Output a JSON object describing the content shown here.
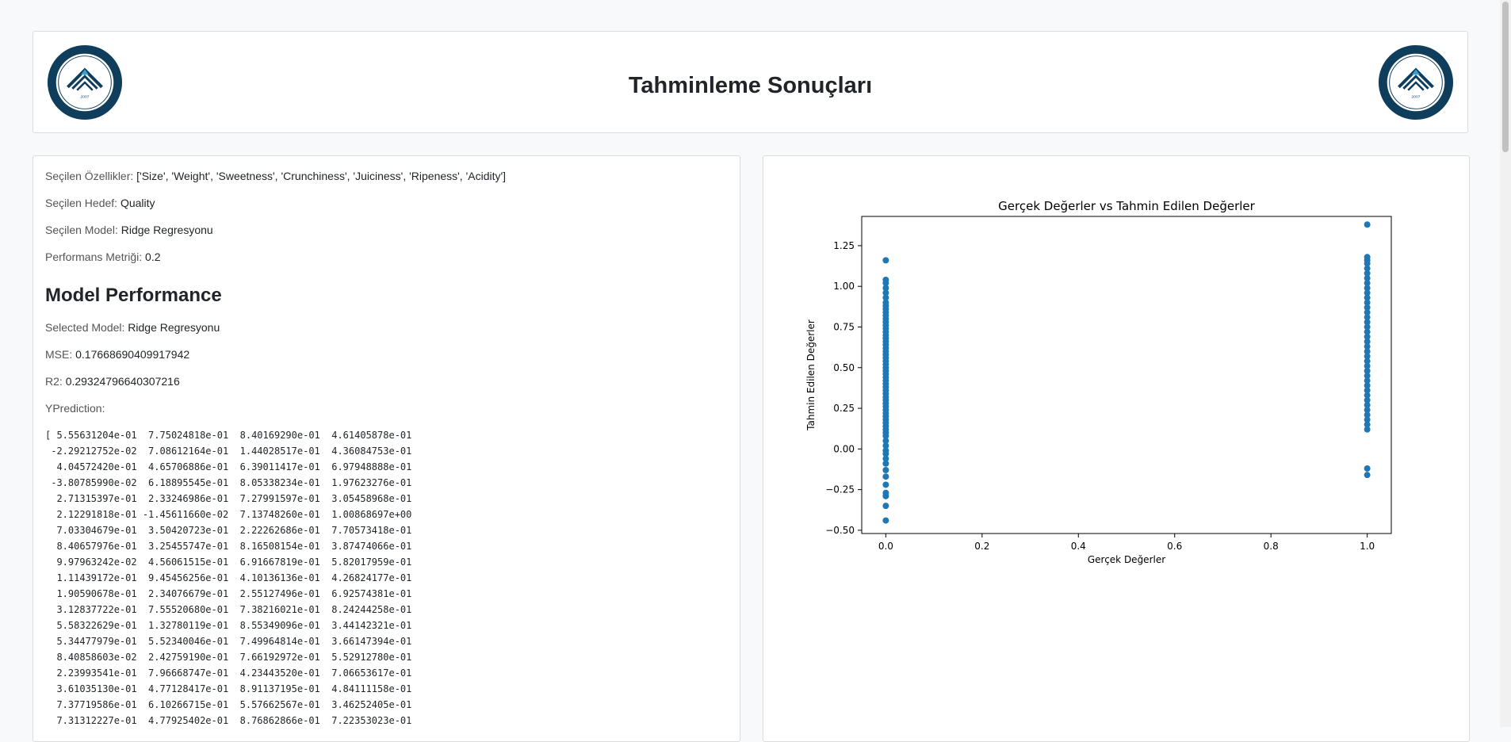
{
  "header": {
    "title": "Tahminleme Sonuçları",
    "logo_left": "university-logo",
    "logo_right": "university-logo",
    "logo_text": "ÇANKIRI KARATEKİN ÜNİVERSİTESİ",
    "logo_year": "2007"
  },
  "summary": {
    "features_label": "Seçilen Özellikler:",
    "features_value": "['Size', 'Weight', 'Sweetness', 'Crunchiness', 'Juiciness', 'Ripeness', 'Acidity']",
    "target_label": "Seçilen Hedef:",
    "target_value": "Quality",
    "model_label": "Seçilen Model:",
    "model_value": "Ridge Regresyonu",
    "metric_label": "Performans Metriği:",
    "metric_value": "0.2"
  },
  "performance": {
    "heading": "Model Performance",
    "selected_model_label": "Selected Model:",
    "selected_model_value": "Ridge Regresyonu",
    "mse_label": "MSE:",
    "mse_value": "0.17668690409917942",
    "r2_label": "R2:",
    "r2_value": "0.29324796640307216",
    "yprediction_label": "YPrediction:",
    "yprediction_lines": [
      "[ 5.55631204e-01  7.75024818e-01  8.40169290e-01  4.61405878e-01",
      " -2.29212752e-02  7.08612164e-01  1.44028517e-01  4.36084753e-01",
      "  4.04572420e-01  4.65706886e-01  6.39011417e-01  6.97948888e-01",
      " -3.80785990e-02  6.18895545e-01  8.05338234e-01  1.97623276e-01",
      "  2.71315397e-01  2.33246986e-01  7.27991597e-01  3.05458968e-01",
      "  2.12291818e-01 -1.45611660e-02  7.13748260e-01  1.00868697e+00",
      "  7.03304679e-01  3.50420723e-01  2.22262686e-01  7.70573418e-01",
      "  8.40657976e-01  3.25455747e-01  8.16508154e-01  3.87474066e-01",
      "  9.97963242e-02  4.56061515e-01  6.91667819e-01  5.82017959e-01",
      "  1.11439172e-01  9.45456256e-01  4.10136136e-01  4.26824177e-01",
      "  1.90590678e-01  2.34076679e-01  2.55127496e-01  6.92574381e-01",
      "  3.12837722e-01  7.55520680e-01  7.38216021e-01  8.24244258e-01",
      "  5.58322629e-01  1.32780119e-01  8.55349096e-01  3.44142321e-01",
      "  5.34477979e-01  5.52340046e-01  7.49964814e-01  3.66147394e-01",
      "  8.40858603e-02  2.42759190e-01  7.66192972e-01  5.52912780e-01",
      "  2.23993541e-01  7.96668747e-01  4.23443520e-01  7.06653617e-01",
      "  3.61035130e-01  4.77128417e-01  8.91137195e-01  4.84111158e-01",
      "  7.37719586e-01  6.10266715e-01  5.57662567e-01  3.46252405e-01",
      "  7.31312227e-01  4.77925402e-01  8.76862866e-01  7.22353023e-01"
    ]
  },
  "chart_data": {
    "type": "scatter",
    "title": "Gerçek Değerler vs Tahmin Edilen Değerler",
    "xlabel": "Gerçek Değerler",
    "ylabel": "Tahmin Edilen Değerler",
    "xlim": [
      -0.05,
      1.05
    ],
    "ylim": [
      -0.52,
      1.43
    ],
    "xticks": [
      "0.0",
      "0.2",
      "0.4",
      "0.6",
      "0.8",
      "1.0"
    ],
    "xtick_values": [
      0,
      0.2,
      0.4,
      0.6,
      0.8,
      1.0
    ],
    "yticks": [
      "−0.50",
      "−0.25",
      "0.00",
      "0.25",
      "0.50",
      "0.75",
      "1.00",
      "1.25"
    ],
    "ytick_values": [
      -0.5,
      -0.25,
      0,
      0.25,
      0.5,
      0.75,
      1.0,
      1.25
    ],
    "grid": false,
    "color": "#1f77b4",
    "series": [
      {
        "x": 0,
        "y": [
          -0.44,
          -0.35,
          -0.29,
          -0.27,
          -0.22,
          -0.17,
          -0.13,
          -0.09,
          -0.06,
          -0.03,
          -0.01,
          0.02,
          0.05,
          0.08,
          0.1,
          0.12,
          0.14,
          0.16,
          0.18,
          0.2,
          0.22,
          0.24,
          0.26,
          0.28,
          0.3,
          0.32,
          0.34,
          0.36,
          0.38,
          0.4,
          0.42,
          0.44,
          0.46,
          0.48,
          0.5,
          0.52,
          0.54,
          0.56,
          0.58,
          0.6,
          0.62,
          0.64,
          0.66,
          0.68,
          0.7,
          0.72,
          0.74,
          0.76,
          0.78,
          0.8,
          0.82,
          0.84,
          0.86,
          0.88,
          0.9,
          0.93,
          0.96,
          0.99,
          1.02,
          1.04,
          1.16
        ]
      },
      {
        "x": 1,
        "y": [
          -0.16,
          -0.12,
          0.12,
          0.15,
          0.18,
          0.21,
          0.24,
          0.27,
          0.3,
          0.33,
          0.36,
          0.39,
          0.42,
          0.45,
          0.48,
          0.51,
          0.54,
          0.57,
          0.6,
          0.63,
          0.66,
          0.69,
          0.72,
          0.75,
          0.78,
          0.81,
          0.84,
          0.87,
          0.9,
          0.93,
          0.96,
          0.99,
          1.02,
          1.05,
          1.08,
          1.11,
          1.14,
          1.16,
          1.18,
          1.38
        ]
      }
    ]
  }
}
